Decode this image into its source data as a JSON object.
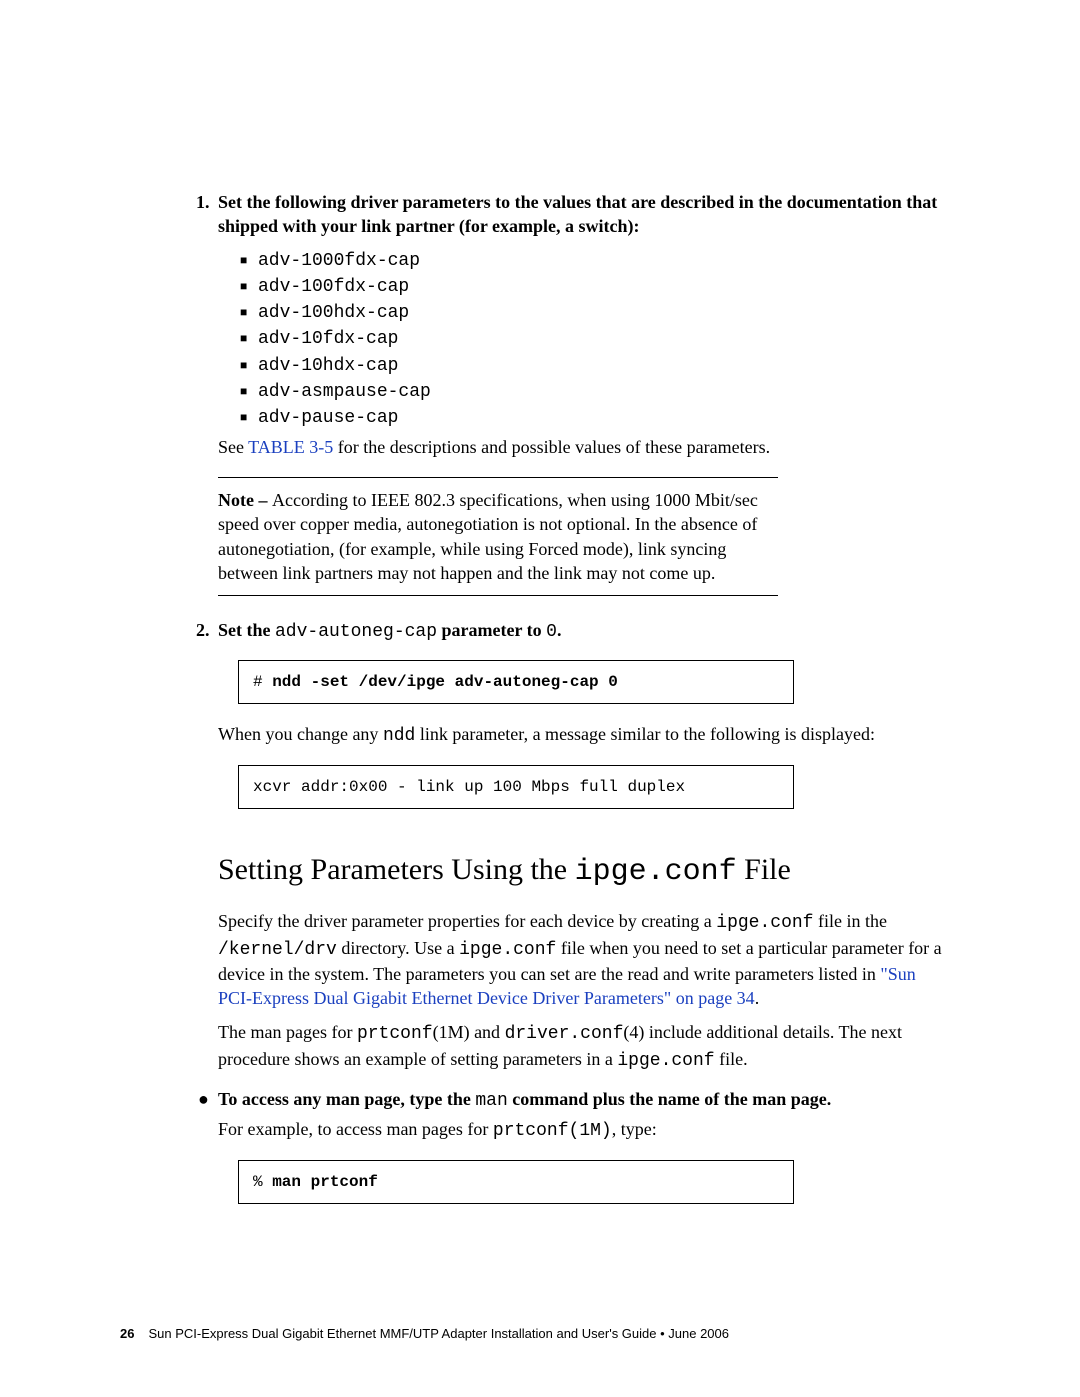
{
  "step1": {
    "num": "1.",
    "lead": "Set the following driver parameters to the values that are described in the documentation that shipped with your link partner (for example, a switch):",
    "params": [
      "adv-1000fdx-cap",
      "adv-100fdx-cap",
      "adv-100hdx-cap",
      "adv-10fdx-cap",
      "adv-10hdx-cap",
      "adv-asmpause-cap",
      "adv-pause-cap"
    ],
    "see_pre": "See ",
    "see_link": "TABLE 3-5",
    "see_post": " for the descriptions and possible values of these parameters."
  },
  "note": {
    "label": "Note – ",
    "text": "According to IEEE 802.3 specifications, when using 1000 Mbit/sec speed over copper media, autonegotiation is not optional. In the absence of autonegotiation, (for example, while using Forced mode), link syncing between link partners may not happen and the link may not come up."
  },
  "step2": {
    "num": "2.",
    "lead_pre": "Set the ",
    "lead_code": "adv-autoneg-cap",
    "lead_post": " parameter to ",
    "lead_val": "0",
    "lead_end": ".",
    "cmd_prompt": "# ",
    "cmd": "ndd -set /dev/ipge adv-autoneg-cap 0",
    "after_pre": "When you change any ",
    "after_code": "ndd",
    "after_post": " link parameter, a message similar to the following is displayed:",
    "output": "xcvr addr:0x00 - link up 100 Mbps full duplex"
  },
  "section": {
    "title_pre": "Setting Parameters Using the ",
    "title_code": "ipge.conf",
    "title_post": " File",
    "p1_a": "Specify the driver parameter properties for each device by creating a ",
    "p1_code1": "ipge.conf",
    "p1_b": " file in the ",
    "p1_code2": "/kernel/drv",
    "p1_c": " directory. Use a ",
    "p1_code3": "ipge.conf",
    "p1_d": " file when you need to set a particular parameter for a device in the system. The parameters you can set are the read and write parameters listed in ",
    "p1_link": "\"Sun PCI-Express Dual Gigabit Ethernet Device Driver Parameters\" on page 34",
    "p1_e": ".",
    "p2_a": "The man pages for ",
    "p2_code1": "prtconf",
    "p2_b": "(1M) and ",
    "p2_code2": "driver.conf",
    "p2_c": "(4) include additional details. The next procedure shows an example of setting parameters in a ",
    "p2_code3": "ipge.conf",
    "p2_d": " file.",
    "bullet_pre": "To access any man page, type the ",
    "bullet_code": "man",
    "bullet_post": " command plus the name of the man page.",
    "bullet_body_a": "For example, to access man pages for ",
    "bullet_body_code": "prtconf(1M)",
    "bullet_body_b": ", type:",
    "cmd_prompt": "% ",
    "cmd": "man prtconf"
  },
  "footer": {
    "page": "26",
    "text": "Sun PCI-Express Dual Gigabit Ethernet MMF/UTP Adapter Installation and User's Guide  •  June 2006"
  }
}
